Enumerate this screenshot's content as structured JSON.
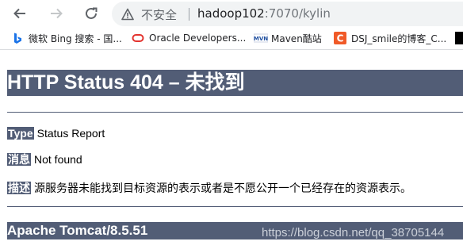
{
  "browser": {
    "security_label": "不安全",
    "url_host": "hadoop102",
    "url_path": ":7070/kylin",
    "icons": [
      "back-arrow-icon",
      "forward-arrow-icon",
      "reload-icon",
      "warning-icon"
    ]
  },
  "bookmarks": [
    {
      "label": "微软 Bing 搜索 - 国...",
      "icon": "bing-icon",
      "color": "#1a73e8"
    },
    {
      "label": "Oracle Developers...",
      "icon": "oracle-icon",
      "color": "#e3342f"
    },
    {
      "label": "Maven酷站",
      "icon": "maven-icon",
      "color": "#1f4fa0"
    },
    {
      "label": "DSJ_smile的博客_C...",
      "icon": "csdn-icon",
      "color": "#f05a28"
    }
  ],
  "page": {
    "title": "HTTP Status 404 – 未找到",
    "type_key": "Type",
    "type_value": "Status Report",
    "message_key": "消息",
    "message_value": "Not found",
    "description_key": "描述",
    "description_value": "源服务器未能找到目标资源的表示或者是不愿公开一个已经存在的资源表示。",
    "server_footer": "Apache Tomcat/8.5.51"
  },
  "watermark": "https://blog.csdn.net/qq_38705144",
  "colors": {
    "tomcat_header": "#525d76"
  }
}
